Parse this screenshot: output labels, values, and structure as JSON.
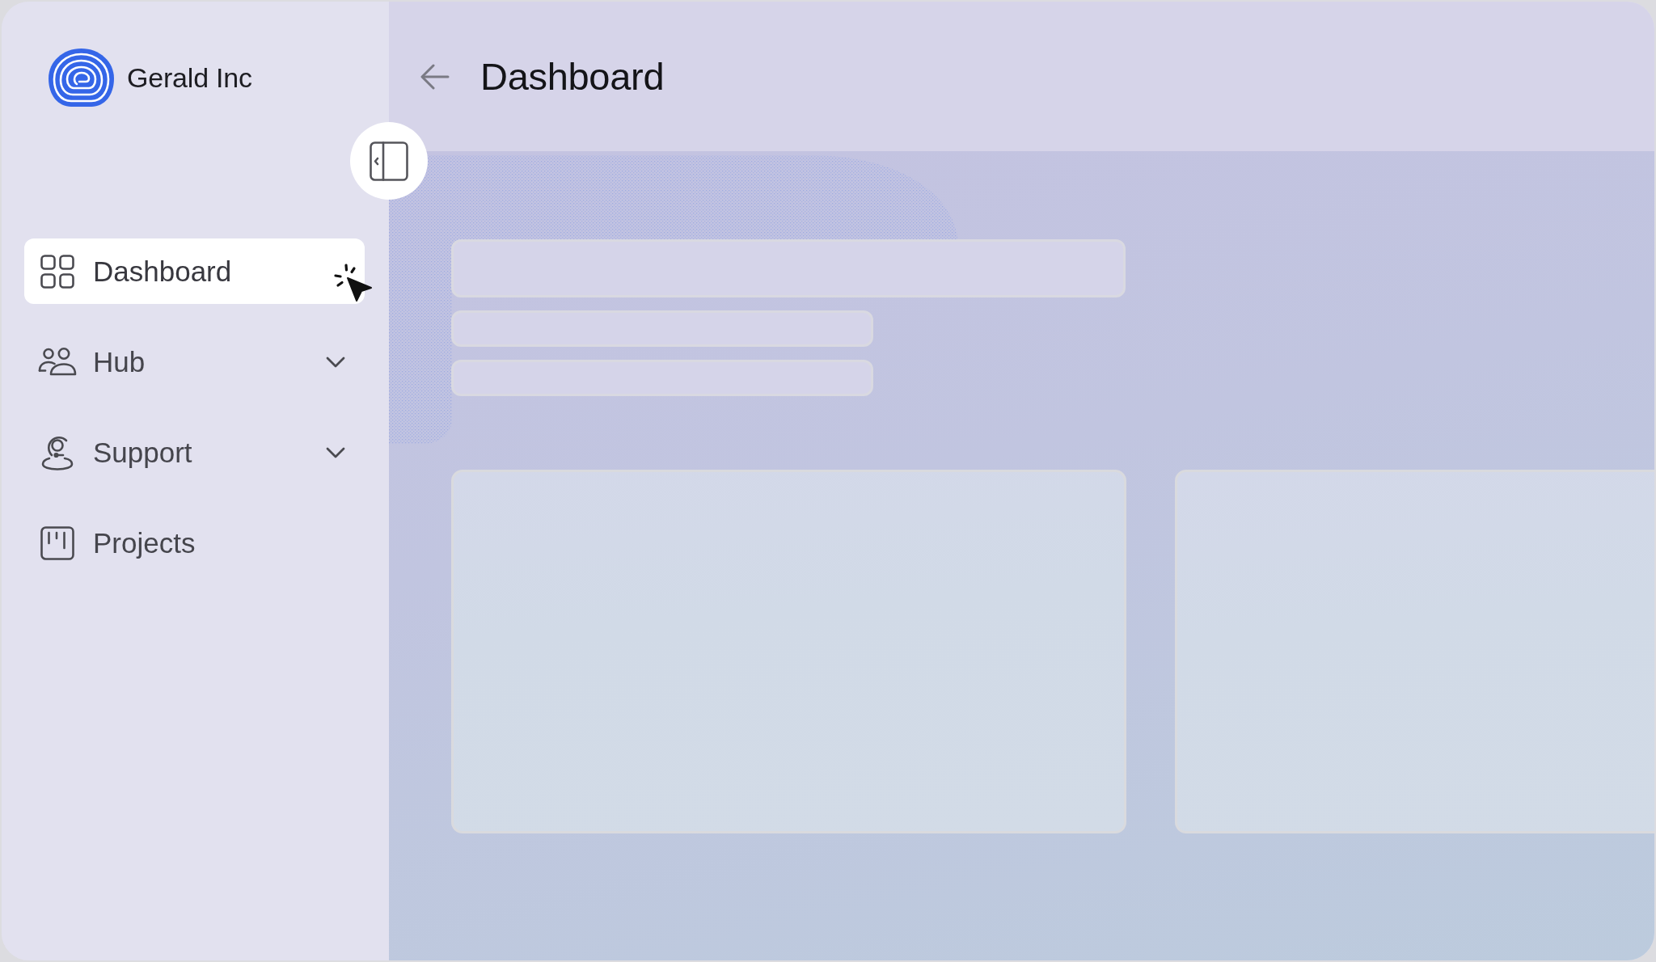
{
  "brand": {
    "name": "Gerald Inc"
  },
  "sidebar": {
    "items": [
      {
        "label": "Dashboard",
        "selected": true
      },
      {
        "label": "Hub",
        "selected": false,
        "expanded": false
      },
      {
        "label": "Support",
        "selected": false,
        "expanded": false
      },
      {
        "label": "Projects",
        "selected": false
      }
    ]
  },
  "header": {
    "title": "Dashboard"
  },
  "content": {
    "skeleton_lines": [
      {
        "kind": "wide"
      },
      {
        "kind": "short"
      },
      {
        "kind": "short"
      }
    ],
    "skeleton_cards": [
      {
        "kind": "panel"
      },
      {
        "kind": "panel"
      }
    ]
  }
}
